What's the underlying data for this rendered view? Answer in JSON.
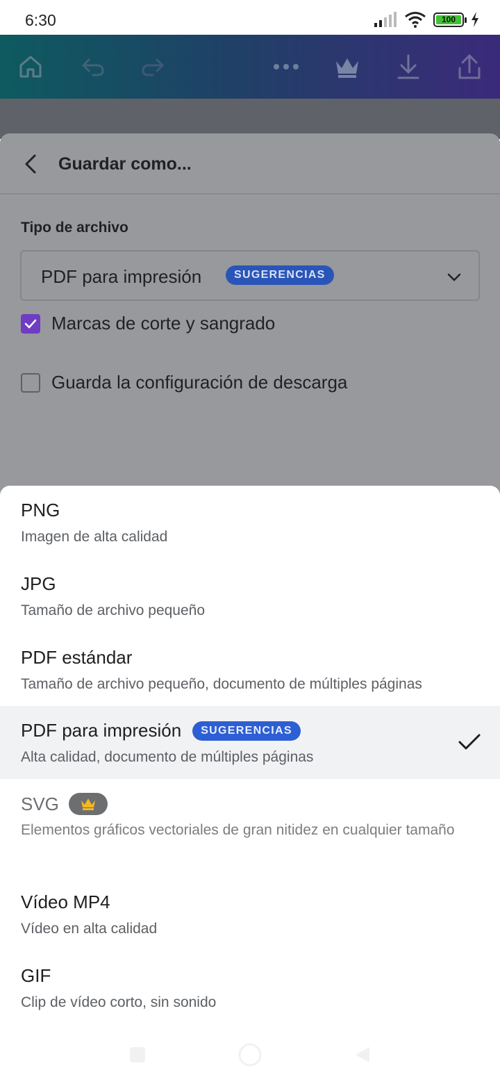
{
  "status_bar": {
    "time": "6:30",
    "battery": "100"
  },
  "app_bar": {
    "icons": [
      "home-icon",
      "undo-icon",
      "redo-icon",
      "more-icon",
      "crown-icon",
      "download-icon",
      "share-icon"
    ]
  },
  "panel": {
    "title": "Guardar como...",
    "file_type_label": "Tipo de archivo",
    "selected_type": "PDF para impresión",
    "selected_badge": "SUGERENCIAS",
    "checkbox_crop_marks": {
      "label": "Marcas de corte y sangrado",
      "checked": true
    },
    "checkbox_save_settings": {
      "label": "Guarda la configuración de descarga",
      "checked": false
    }
  },
  "options": [
    {
      "name": "PNG",
      "desc": "Imagen de alta calidad"
    },
    {
      "name": "JPG",
      "desc": "Tamaño de archivo pequeño"
    },
    {
      "name": "PDF estándar",
      "desc": "Tamaño de archivo pequeño, documento de múltiples páginas"
    },
    {
      "name": "PDF para impresión",
      "badge": "SUGERENCIAS",
      "desc": "Alta calidad, documento de múltiples páginas",
      "selected": true
    },
    {
      "name": "SVG",
      "desc": "Elementos gráficos vectoriales de gran nitidez en cualquier tamaño",
      "premium": true
    },
    {
      "name": "Vídeo MP4",
      "desc": "Vídeo en alta calidad"
    },
    {
      "name": "GIF",
      "desc": "Clip de vídeo corto, sin sonido"
    }
  ],
  "colors": {
    "accent": "#2c5fd4",
    "checkbox": "#6f3cc4",
    "crown": "#f2b824"
  }
}
